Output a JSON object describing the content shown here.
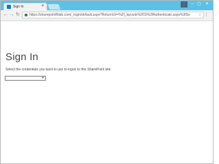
{
  "browser": {
    "tab": {
      "title": "Sign In",
      "close_icon": "close-icon"
    },
    "url": "https://sharepointfhlab.com/_login/default.aspx?ReturnUrl=%2f_layouts%2f15%2fAuthenticate.aspx%3fSo",
    "window_controls": {
      "user_icon": "person-icon",
      "minimize": "minimize-icon",
      "maximize": "maximize-icon",
      "close": "close-icon"
    },
    "nav": {
      "back": "back-arrow-icon",
      "forward": "forward-arrow-icon",
      "reload": "reload-icon"
    },
    "colors": {
      "titlebar": "#5bc2e7",
      "toolbar": "#f2f2f2",
      "secure_lock": "#1e8e3e"
    }
  },
  "page": {
    "title": "Sign In",
    "instruction": "Select the credentials you want to use to logon to this SharePoint site:",
    "credential_select": {
      "selected": ""
    }
  }
}
